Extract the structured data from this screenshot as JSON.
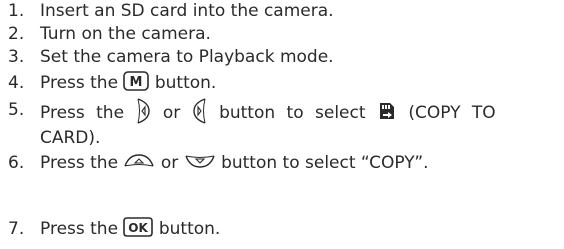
{
  "steps": [
    {
      "num": "1.",
      "text": "Insert an SD card into the camera."
    },
    {
      "num": "2.",
      "text": "Turn on the camera."
    },
    {
      "num": "3.",
      "text": "Set the camera to Playback mode."
    },
    {
      "num": "4.",
      "parts": [
        "Press the",
        "button."
      ]
    },
    {
      "num": "5.",
      "parts": [
        "Press the",
        "or",
        "button to select",
        "(COPY TO",
        "CARD)."
      ]
    },
    {
      "num": "6.",
      "parts": [
        "Press the",
        "or",
        "button to select “COPY”."
      ]
    },
    {
      "num": "7.",
      "parts": [
        "Press the",
        "button."
      ]
    }
  ],
  "icons": {
    "menu_button_label": "M",
    "ok_button_label": "OK",
    "left_button": "left-arrow-button-icon",
    "right_button": "right-arrow-button-icon",
    "copy_to_card": "copy-to-card-icon",
    "up_button": "up-arrow-button-icon",
    "down_button": "down-arrow-button-icon"
  },
  "colors": {
    "text": "#2a2a2a"
  }
}
